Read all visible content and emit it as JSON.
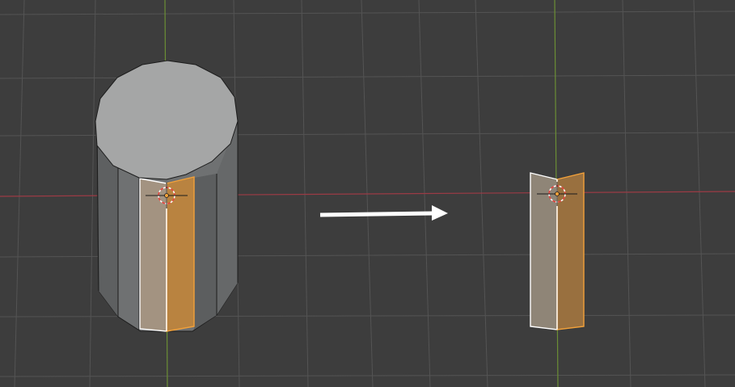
{
  "viewport": {
    "mode": "edit-mode",
    "background_color": "#3d3d3d",
    "grid_color": "#545454",
    "x_axis_color": "#9b3b45",
    "y_axis_color": "#6b8e35"
  },
  "colors": {
    "mesh_face": "#a5a6a6",
    "mesh_side": "#6f7172",
    "mesh_edge": "#1c1c1c",
    "selected_face": "#c98a3a",
    "selected_edge": "#f2a13a",
    "active_face": "#ffffff",
    "cursor_red": "#e8423c",
    "cursor_white": "#ffffff",
    "arrow": "#ffffff"
  },
  "icons": {
    "cursor": "3d-cursor-icon",
    "arrow": "arrow-right-icon"
  },
  "objects": [
    {
      "name": "cylinder-mesh",
      "state": "before",
      "selected_faces": 2
    },
    {
      "name": "isolated-faces",
      "state": "after",
      "selected_faces": 2
    }
  ]
}
